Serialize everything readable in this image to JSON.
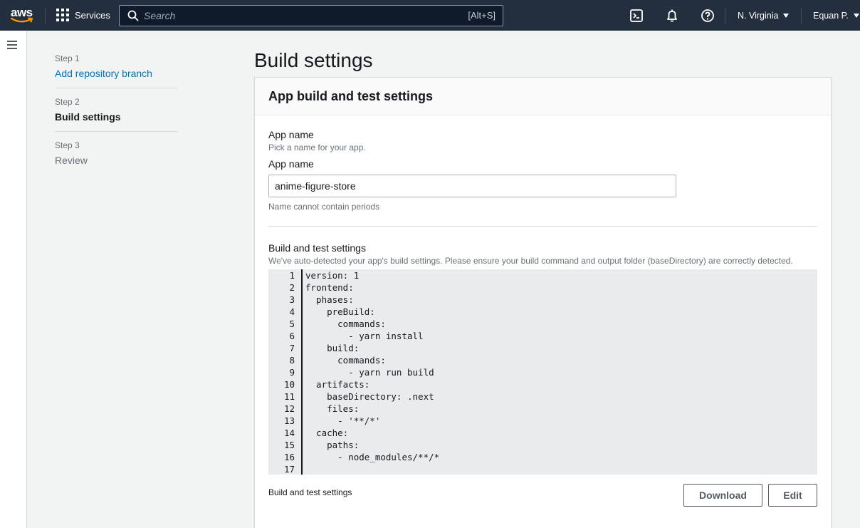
{
  "topnav": {
    "logo_text": "aws",
    "services_label": "Services",
    "search_placeholder": "Search",
    "search_shortcut": "[Alt+S]",
    "region": "N. Virginia",
    "user": "Equan P."
  },
  "steps": [
    {
      "num": "Step 1",
      "label": "Add repository branch",
      "state": "link"
    },
    {
      "num": "Step 2",
      "label": "Build settings",
      "state": "current"
    },
    {
      "num": "Step 3",
      "label": "Review",
      "state": "disabled"
    }
  ],
  "page": {
    "title": "Build settings",
    "panel_title": "App build and test settings"
  },
  "app_name": {
    "section_label": "App name",
    "section_desc": "Pick a name for your app.",
    "input_label": "App name",
    "value": "anime-figure-store",
    "constraint": "Name cannot contain periods"
  },
  "build": {
    "section_label": "Build and test settings",
    "section_desc": "We've auto-detected your app's build settings. Please ensure your build command and output folder (baseDirectory) are correctly detected.",
    "lines": [
      "version: 1",
      "frontend:",
      "  phases:",
      "    preBuild:",
      "      commands:",
      "        - yarn install",
      "    build:",
      "      commands:",
      "        - yarn run build",
      "  artifacts:",
      "    baseDirectory: .next",
      "    files:",
      "      - '**/*'",
      "  cache:",
      "    paths:",
      "      - node_modules/**/*",
      ""
    ],
    "footer_note": "Build and test settings",
    "download_label": "Download",
    "edit_label": "Edit"
  },
  "colors": {
    "nav_bg": "#232f3e",
    "link": "#0073bb",
    "aws_orange": "#ff9900",
    "code_bg": "#e9ebed"
  }
}
